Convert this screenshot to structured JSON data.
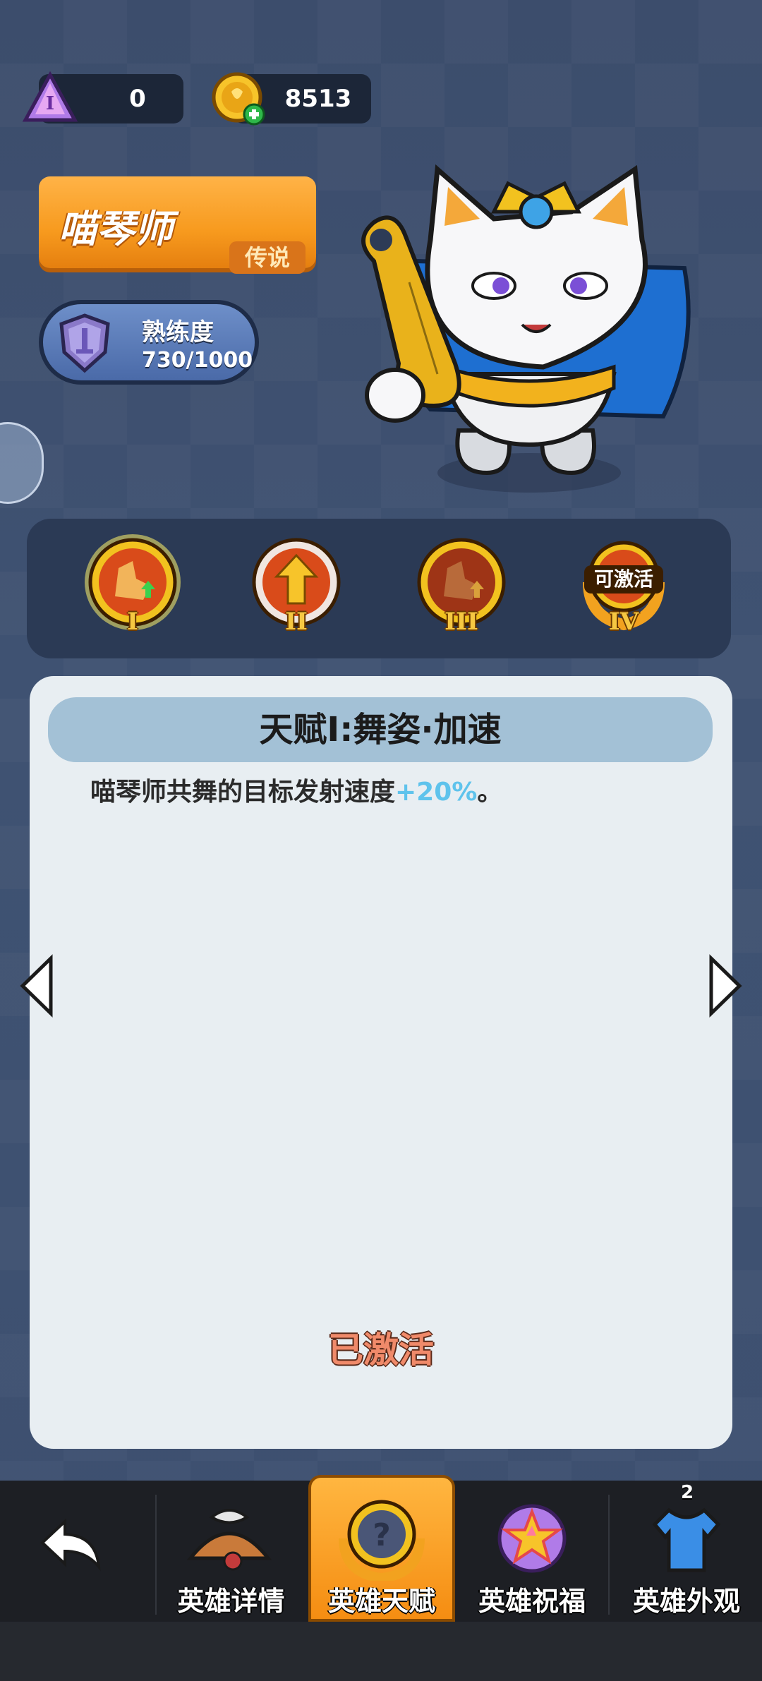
{
  "currency": {
    "gem": {
      "icon": "purple-gem-icon",
      "value": "0"
    },
    "gold": {
      "icon": "gold-coin-plus-icon",
      "value": "8513"
    }
  },
  "hero": {
    "name": "喵琴师",
    "rarity": "传说",
    "mastery_label": "熟练度",
    "mastery_value": "730/1000",
    "mastery_progress": 0.73,
    "portrait": "white-cat-lyre-hero"
  },
  "talents": {
    "nodes": [
      {
        "numeral": "I",
        "state": "selected",
        "icon": "dance-boot-up-arrow-icon"
      },
      {
        "numeral": "II",
        "state": "unlocked",
        "icon": "up-arrow-icon"
      },
      {
        "numeral": "III",
        "state": "locked",
        "icon": "dance-boot-up-arrow-icon"
      },
      {
        "numeral": "IV",
        "state": "activatable",
        "badge": "可激活",
        "icon": "laurel-emblem-icon"
      }
    ]
  },
  "panel": {
    "title": "天赋Ⅰ:舞姿·加速",
    "desc_prefix": "喵琴师共舞的目标发射速度",
    "desc_highlight": "+20%",
    "desc_suffix": "。",
    "status": "已激活"
  },
  "nav": {
    "back_icon": "back-arrow-icon",
    "items": [
      {
        "label": "英雄详情",
        "icon": "hero-detail-icon"
      },
      {
        "label": "英雄天赋",
        "icon": "question-emblem-icon",
        "selected": true
      },
      {
        "label": "英雄祝福",
        "icon": "star-blessing-icon"
      },
      {
        "label": "英雄外观",
        "icon": "shirt-icon",
        "badge": "2"
      }
    ]
  },
  "colors": {
    "accent_orange": "#f79a1e",
    "highlight_blue": "#5fc3ec",
    "status_text": "#f08a6a"
  }
}
